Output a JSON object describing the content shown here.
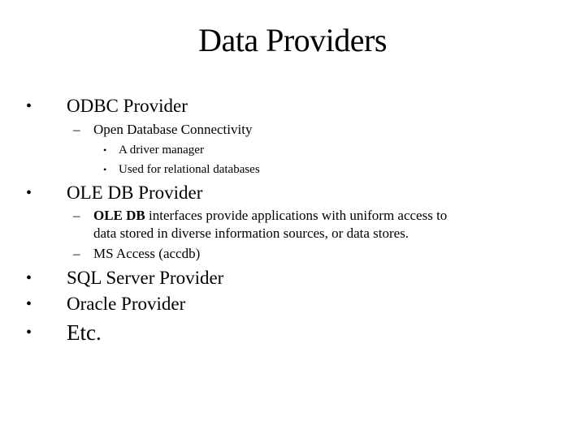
{
  "slide": {
    "title": "Data Providers",
    "items": [
      {
        "label": "ODBC Provider",
        "sub": [
          {
            "label": "Open Database Connectivity",
            "sub": [
              {
                "label": "A driver manager"
              },
              {
                "label": "Used for relational databases"
              }
            ]
          }
        ]
      },
      {
        "label": "OLE DB Provider",
        "sub": [
          {
            "bold": "OLE DB",
            "line1": "interfaces provide applications with uniform access to",
            "line2": "data stored in diverse information sources, or data stores."
          },
          {
            "label": "MS Access (accdb)"
          }
        ]
      },
      {
        "label": "SQL Server Provider"
      },
      {
        "label": "Oracle Provider"
      },
      {
        "label": "Etc."
      }
    ],
    "bullet_marks": {
      "level1": "•",
      "level2": "–",
      "level3": "•"
    }
  }
}
